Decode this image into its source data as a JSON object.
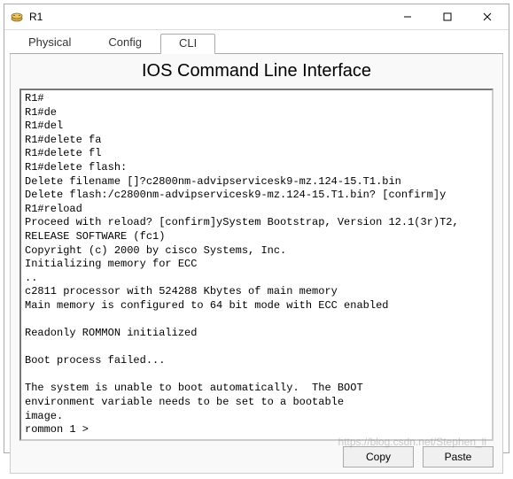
{
  "window": {
    "title": "R1"
  },
  "tabs": {
    "physical": "Physical",
    "config": "Config",
    "cli": "CLI"
  },
  "cli": {
    "title": "IOS Command Line Interface",
    "terminal_text": "R1#\nR1#de\nR1#del\nR1#delete fa\nR1#delete fl\nR1#delete flash:\nDelete filename []?c2800nm-advipservicesk9-mz.124-15.T1.bin\nDelete flash:/c2800nm-advipservicesk9-mz.124-15.T1.bin? [confirm]y\nR1#reload\nProceed with reload? [confirm]ySystem Bootstrap, Version 12.1(3r)T2, RELEASE SOFTWARE (fc1)\nCopyright (c) 2000 by cisco Systems, Inc.\nInitializing memory for ECC\n..\nc2811 processor with 524288 Kbytes of main memory\nMain memory is configured to 64 bit mode with ECC enabled\n\nReadonly ROMMON initialized\n\nBoot process failed...\n\nThe system is unable to boot automatically.  The BOOT\nenvironment variable needs to be set to a bootable\nimage.\nrommon 1 >"
  },
  "buttons": {
    "copy": "Copy",
    "paste": "Paste"
  },
  "watermark": "https://blog.csdn.net/Stephen_li"
}
